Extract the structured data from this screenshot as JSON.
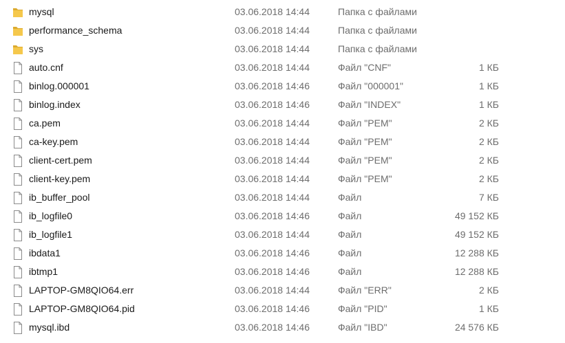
{
  "files": [
    {
      "name": "mysql",
      "date": "03.06.2018 14:44",
      "type": "Папка с файлами",
      "size": "",
      "icon": "folder-icon"
    },
    {
      "name": "performance_schema",
      "date": "03.06.2018 14:44",
      "type": "Папка с файлами",
      "size": "",
      "icon": "folder-icon"
    },
    {
      "name": "sys",
      "date": "03.06.2018 14:44",
      "type": "Папка с файлами",
      "size": "",
      "icon": "folder-icon"
    },
    {
      "name": "auto.cnf",
      "date": "03.06.2018 14:44",
      "type": "Файл \"CNF\"",
      "size": "1 КБ",
      "icon": "file-icon"
    },
    {
      "name": "binlog.000001",
      "date": "03.06.2018 14:46",
      "type": "Файл \"000001\"",
      "size": "1 КБ",
      "icon": "file-icon"
    },
    {
      "name": "binlog.index",
      "date": "03.06.2018 14:46",
      "type": "Файл \"INDEX\"",
      "size": "1 КБ",
      "icon": "file-icon"
    },
    {
      "name": "ca.pem",
      "date": "03.06.2018 14:44",
      "type": "Файл \"PEM\"",
      "size": "2 КБ",
      "icon": "file-icon"
    },
    {
      "name": "ca-key.pem",
      "date": "03.06.2018 14:44",
      "type": "Файл \"PEM\"",
      "size": "2 КБ",
      "icon": "file-icon"
    },
    {
      "name": "client-cert.pem",
      "date": "03.06.2018 14:44",
      "type": "Файл \"PEM\"",
      "size": "2 КБ",
      "icon": "file-icon"
    },
    {
      "name": "client-key.pem",
      "date": "03.06.2018 14:44",
      "type": "Файл \"PEM\"",
      "size": "2 КБ",
      "icon": "file-icon"
    },
    {
      "name": "ib_buffer_pool",
      "date": "03.06.2018 14:44",
      "type": "Файл",
      "size": "7 КБ",
      "icon": "file-icon"
    },
    {
      "name": "ib_logfile0",
      "date": "03.06.2018 14:46",
      "type": "Файл",
      "size": "49 152 КБ",
      "icon": "file-icon"
    },
    {
      "name": "ib_logfile1",
      "date": "03.06.2018 14:44",
      "type": "Файл",
      "size": "49 152 КБ",
      "icon": "file-icon"
    },
    {
      "name": "ibdata1",
      "date": "03.06.2018 14:46",
      "type": "Файл",
      "size": "12 288 КБ",
      "icon": "file-icon"
    },
    {
      "name": "ibtmp1",
      "date": "03.06.2018 14:46",
      "type": "Файл",
      "size": "12 288 КБ",
      "icon": "file-icon"
    },
    {
      "name": "LAPTOP-GM8QIO64.err",
      "date": "03.06.2018 14:44",
      "type": "Файл \"ERR\"",
      "size": "2 КБ",
      "icon": "file-icon"
    },
    {
      "name": "LAPTOP-GM8QIO64.pid",
      "date": "03.06.2018 14:46",
      "type": "Файл \"PID\"",
      "size": "1 КБ",
      "icon": "file-icon"
    },
    {
      "name": "mysql.ibd",
      "date": "03.06.2018 14:46",
      "type": "Файл \"IBD\"",
      "size": "24 576 КБ",
      "icon": "file-icon"
    }
  ],
  "colors": {
    "folder": "#f5c84c",
    "folder_dark": "#dcaa2e",
    "file_border": "#8a8a8a",
    "secondary_text": "#6d6d6d"
  }
}
